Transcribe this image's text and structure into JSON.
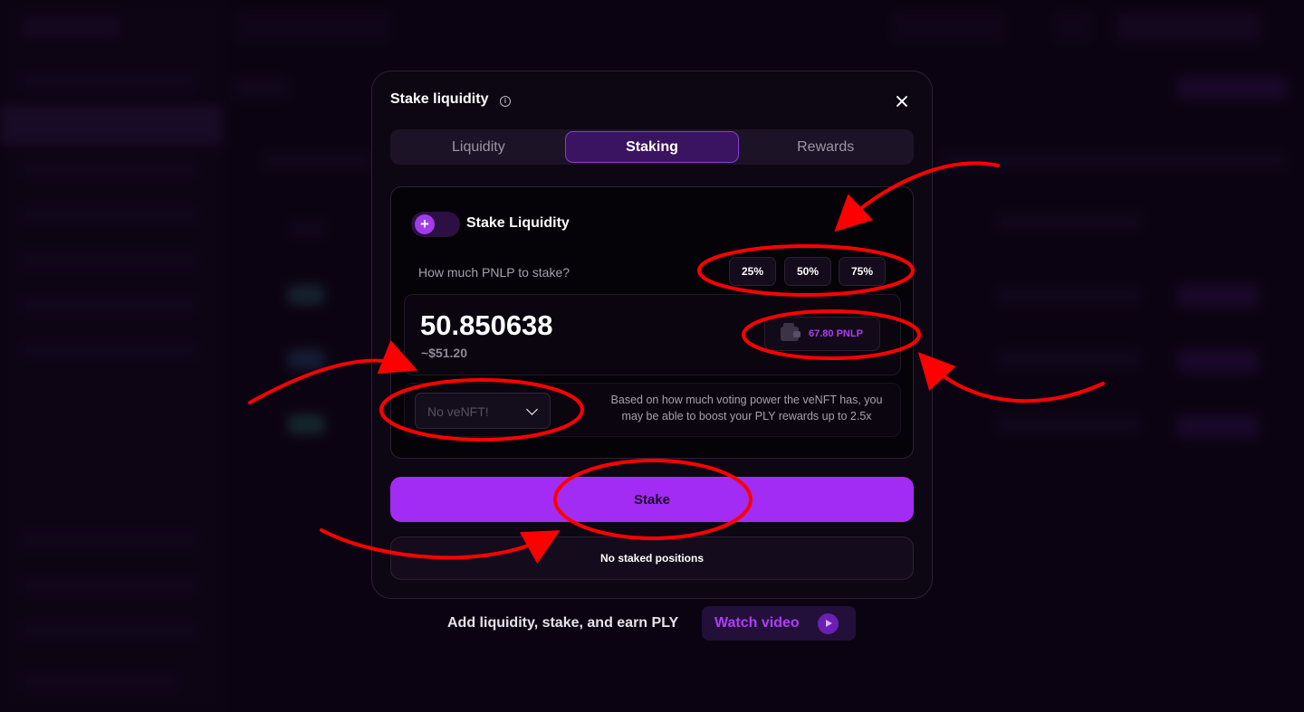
{
  "modal": {
    "title": "Stake liquidity",
    "info_icon_glyph": "i",
    "tabs": [
      {
        "label": "Liquidity",
        "active": false
      },
      {
        "label": "Staking",
        "active": true
      },
      {
        "label": "Rewards",
        "active": false
      }
    ],
    "toggle": {
      "label": "Stake Liquidity",
      "icon": "plus-icon",
      "glyph": "+"
    },
    "question": "How much PNLP to stake?",
    "percent_buttons": [
      "25%",
      "50%",
      "75%"
    ],
    "amount": {
      "value": "50.850638",
      "usd": "~$51.20"
    },
    "balance": {
      "label": "67.80 PNLP",
      "icon": "wallet-icon"
    },
    "venft": {
      "placeholder": "No veNFT!",
      "info": "Based on how much voting power the veNFT has, you may be able to boost your PLY rewards up to 2.5x"
    },
    "stake_button": "Stake",
    "positions_text": "No staked positions"
  },
  "footer": {
    "text": "Add liquidity, stake, and earn PLY",
    "watch_button": "Watch video"
  },
  "colors": {
    "accent": "#a32cf5",
    "annotation": "#ff0000",
    "background": "#0f0517"
  }
}
